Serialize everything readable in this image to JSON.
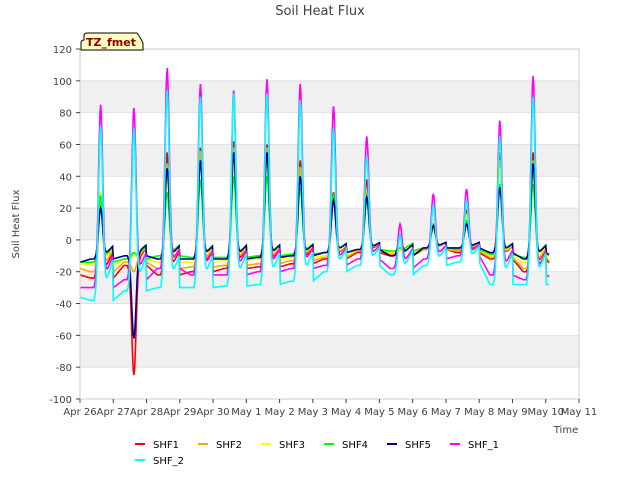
{
  "chart_data": {
    "type": "line",
    "title": "Soil Heat Flux",
    "xlabel": "Time",
    "ylabel": "Soil Heat Flux",
    "tag": "TZ_fmet",
    "ylim": [
      -100,
      120
    ],
    "yticks": [
      -100,
      -80,
      -60,
      -40,
      -20,
      0,
      20,
      40,
      60,
      80,
      100,
      120
    ],
    "xlim": [
      0,
      15
    ],
    "xticks": [
      0,
      1,
      2,
      3,
      4,
      5,
      6,
      7,
      8,
      9,
      10,
      11,
      12,
      13,
      14,
      15
    ],
    "xtick_labels": [
      "Apr 26",
      "Apr 27",
      "Apr 28",
      "Apr 29",
      "Apr 30",
      "May 1",
      "May 2",
      "May 3",
      "May 4",
      "May 5",
      "May 6",
      "May 7",
      "May 8",
      "May 9",
      "May 10",
      "May 11"
    ],
    "grid": "horizontal bands",
    "legend_position": "bottom",
    "series": [
      {
        "name": "SHF1",
        "color": "#ff0000",
        "peaks": [
          30,
          -85,
          55,
          58,
          62,
          60,
          50,
          30,
          38,
          -5,
          10,
          18,
          55,
          55
        ],
        "troughs": [
          -24,
          -16,
          -22,
          -20,
          -18,
          -17,
          -15,
          -12,
          -8,
          -10,
          -6,
          -8,
          -12,
          -20
        ],
        "start": -22
      },
      {
        "name": "SHF2",
        "color": "#ffa500",
        "peaks": [
          25,
          -20,
          48,
          56,
          58,
          58,
          46,
          28,
          30,
          -6,
          10,
          16,
          50,
          50
        ],
        "troughs": [
          -20,
          -14,
          -18,
          -17,
          -16,
          -15,
          -13,
          -11,
          -7,
          -9,
          -6,
          -7,
          -11,
          -18
        ],
        "start": -18
      },
      {
        "name": "SHF3",
        "color": "#ffff00",
        "peaks": [
          30,
          -10,
          40,
          48,
          50,
          50,
          40,
          26,
          28,
          -6,
          9,
          15,
          45,
          45
        ],
        "troughs": [
          -16,
          -12,
          -14,
          -14,
          -13,
          -12,
          -11,
          -10,
          -6,
          -8,
          -5,
          -6,
          -10,
          -14
        ],
        "start": -15
      },
      {
        "name": "SHF4",
        "color": "#00ff00",
        "peaks": [
          28,
          -8,
          30,
          38,
          40,
          40,
          33,
          28,
          25,
          -5,
          8,
          12,
          35,
          35
        ],
        "troughs": [
          -14,
          -12,
          -10,
          -11,
          -11,
          -10,
          -9,
          -8,
          -6,
          -7,
          -5,
          -6,
          -9,
          -11
        ],
        "start": -14
      },
      {
        "name": "SHF5",
        "color": "#00008b",
        "peaks": [
          20,
          -62,
          45,
          50,
          55,
          55,
          40,
          25,
          27,
          2,
          9,
          10,
          33,
          48
        ],
        "troughs": [
          -12,
          -10,
          -12,
          -12,
          -12,
          -11,
          -10,
          -8,
          -6,
          -10,
          -5,
          -5,
          -8,
          -12
        ],
        "start": -14
      },
      {
        "name": "SHF_1",
        "color": "#ff00ff",
        "peaks": [
          85,
          83,
          108,
          98,
          94,
          101,
          98,
          84,
          65,
          10,
          29,
          32,
          75,
          103
        ],
        "troughs": [
          -30,
          -25,
          -18,
          -22,
          -22,
          -20,
          -18,
          -16,
          -12,
          -18,
          -12,
          -10,
          -22,
          -25
        ],
        "start": -30
      },
      {
        "name": "SHF_2",
        "color": "#00ffff",
        "peaks": [
          72,
          70,
          94,
          90,
          92,
          92,
          88,
          70,
          53,
          3,
          22,
          25,
          65,
          90
        ],
        "troughs": [
          -38,
          -32,
          -30,
          -30,
          -29,
          -28,
          -26,
          -20,
          -16,
          -22,
          -16,
          -14,
          -28,
          -28
        ],
        "start": -36
      }
    ]
  }
}
